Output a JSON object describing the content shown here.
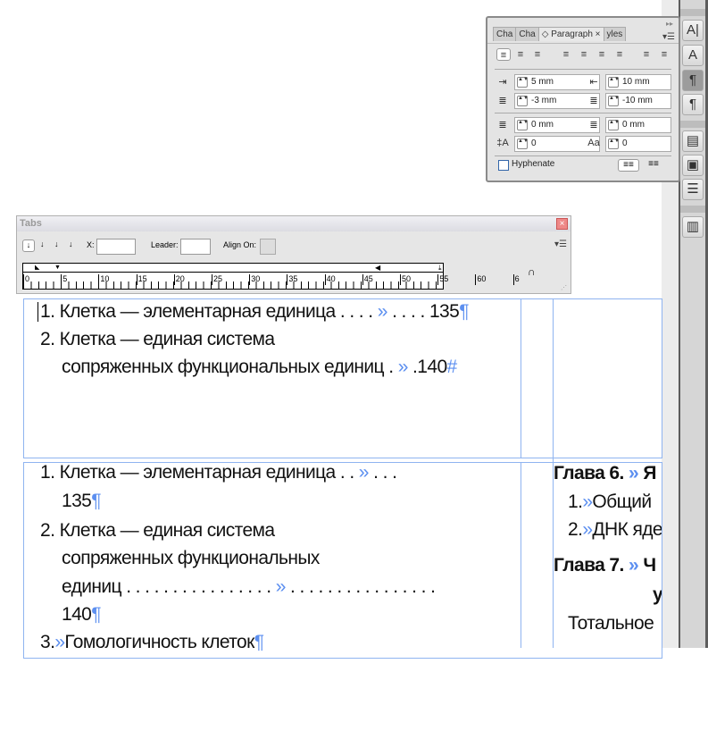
{
  "paragraph_panel": {
    "tabs": [
      "Cha",
      "Cha",
      "◇ Paragraph",
      "yles"
    ],
    "close": "×",
    "left_indent": "5 mm",
    "right_indent": "10 mm",
    "first_line_indent": "-3 mm",
    "last_line_indent": "-10 mm",
    "space_before": "0 mm",
    "space_after": "0 mm",
    "drop_cap_lines": "0",
    "drop_cap_chars": "0",
    "hyphenate_label": "Hyphenate",
    "hyphenate_checked": false
  },
  "tabs_panel": {
    "title": "Tabs",
    "x_label": "X:",
    "x_value": "",
    "leader_label": "Leader:",
    "leader_value": "",
    "align_on_label": "Align On:",
    "ruler_labels": [
      "0",
      "5",
      "10",
      "15",
      "20",
      "25",
      "30",
      "35",
      "40",
      "45",
      "50",
      "55",
      "60",
      "6"
    ]
  },
  "frame1": {
    "line1": {
      "num": "1.",
      "text": " Клетка — элементарная единица",
      "lead1": " . . . . ",
      "tab": "»",
      "lead2": " . . . . ",
      "page": "135",
      "mark": "¶"
    },
    "line2": {
      "num": "2.",
      "text": " Клетка — единая система"
    },
    "line3": {
      "text": "сопряженных функциональных единиц",
      "lead1": " . ",
      "tab": "»",
      "lead2": " .",
      "page": "140",
      "mark": "#"
    }
  },
  "frame2": {
    "line1": {
      "num": "1.",
      "text": " Клетка — элементарная единица",
      "lead1": " . . ",
      "tab": "»",
      "lead2": " . . ."
    },
    "line2": {
      "page": "135",
      "mark": "¶"
    },
    "line3": {
      "num": "2.",
      "text": " Клетка — единая система"
    },
    "line4": {
      "text": "сопряженных функциональных"
    },
    "line5": {
      "text": "единиц",
      "lead1": " . . . . . . . . . . . . . . . . ",
      "tab": "»",
      "lead2": " . . . . . . . . . . . . . . . ."
    },
    "line6": {
      "page": "140",
      "mark": "¶"
    },
    "line7": {
      "num": "3.",
      "tab": "»",
      "text": "Гомологичность клеток",
      "mark": "¶"
    }
  },
  "frame3": {
    "h1": {
      "text": "Глава 6.",
      "tab": "»",
      "rest": "Я"
    },
    "i1": {
      "num": "1.",
      "tab": "»",
      "text": "Общий"
    },
    "i2": {
      "num": "2.",
      "tab": "»",
      "text": "ДНК яде"
    },
    "h2": {
      "text": "Глава 7.",
      "tab": "»",
      "rest": "Ч"
    },
    "h2b": "у",
    "p": "Тотальное"
  }
}
